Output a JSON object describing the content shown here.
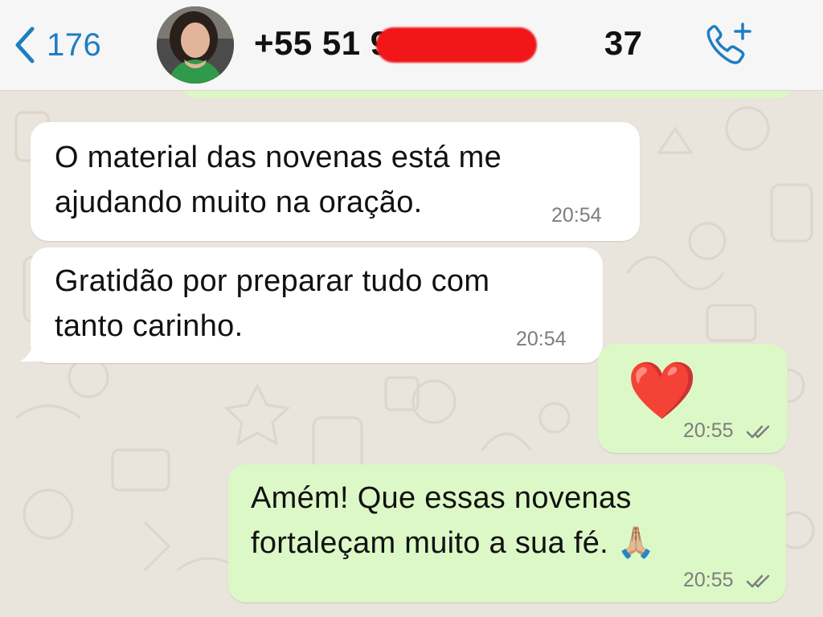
{
  "header": {
    "back_count": "176",
    "contact_name": "+55 51 9       37",
    "avatar_icon": "contact-photo",
    "call_icon": "add-call-icon"
  },
  "messages": [
    {
      "direction": "in",
      "text": "O material das novenas está me\najudando muito na oração.",
      "time": "20:54"
    },
    {
      "direction": "in",
      "text": "Gratidão por preparar tudo com\ntanto carinho.",
      "time": "20:54"
    },
    {
      "direction": "out",
      "emoji": "❤️",
      "time": "20:55",
      "status": "read"
    },
    {
      "direction": "out",
      "text": "Amém! Que essas novenas\nfortaleçam muito a sua fé. 🙏🏼",
      "time": "20:55",
      "status": "read"
    }
  ],
  "colors": {
    "accent": "#1d7ec2",
    "outgoing_bubble": "#dcf8c6",
    "incoming_bubble": "#ffffff",
    "chat_background": "#e9e4dc",
    "redaction": "#f0161a"
  }
}
